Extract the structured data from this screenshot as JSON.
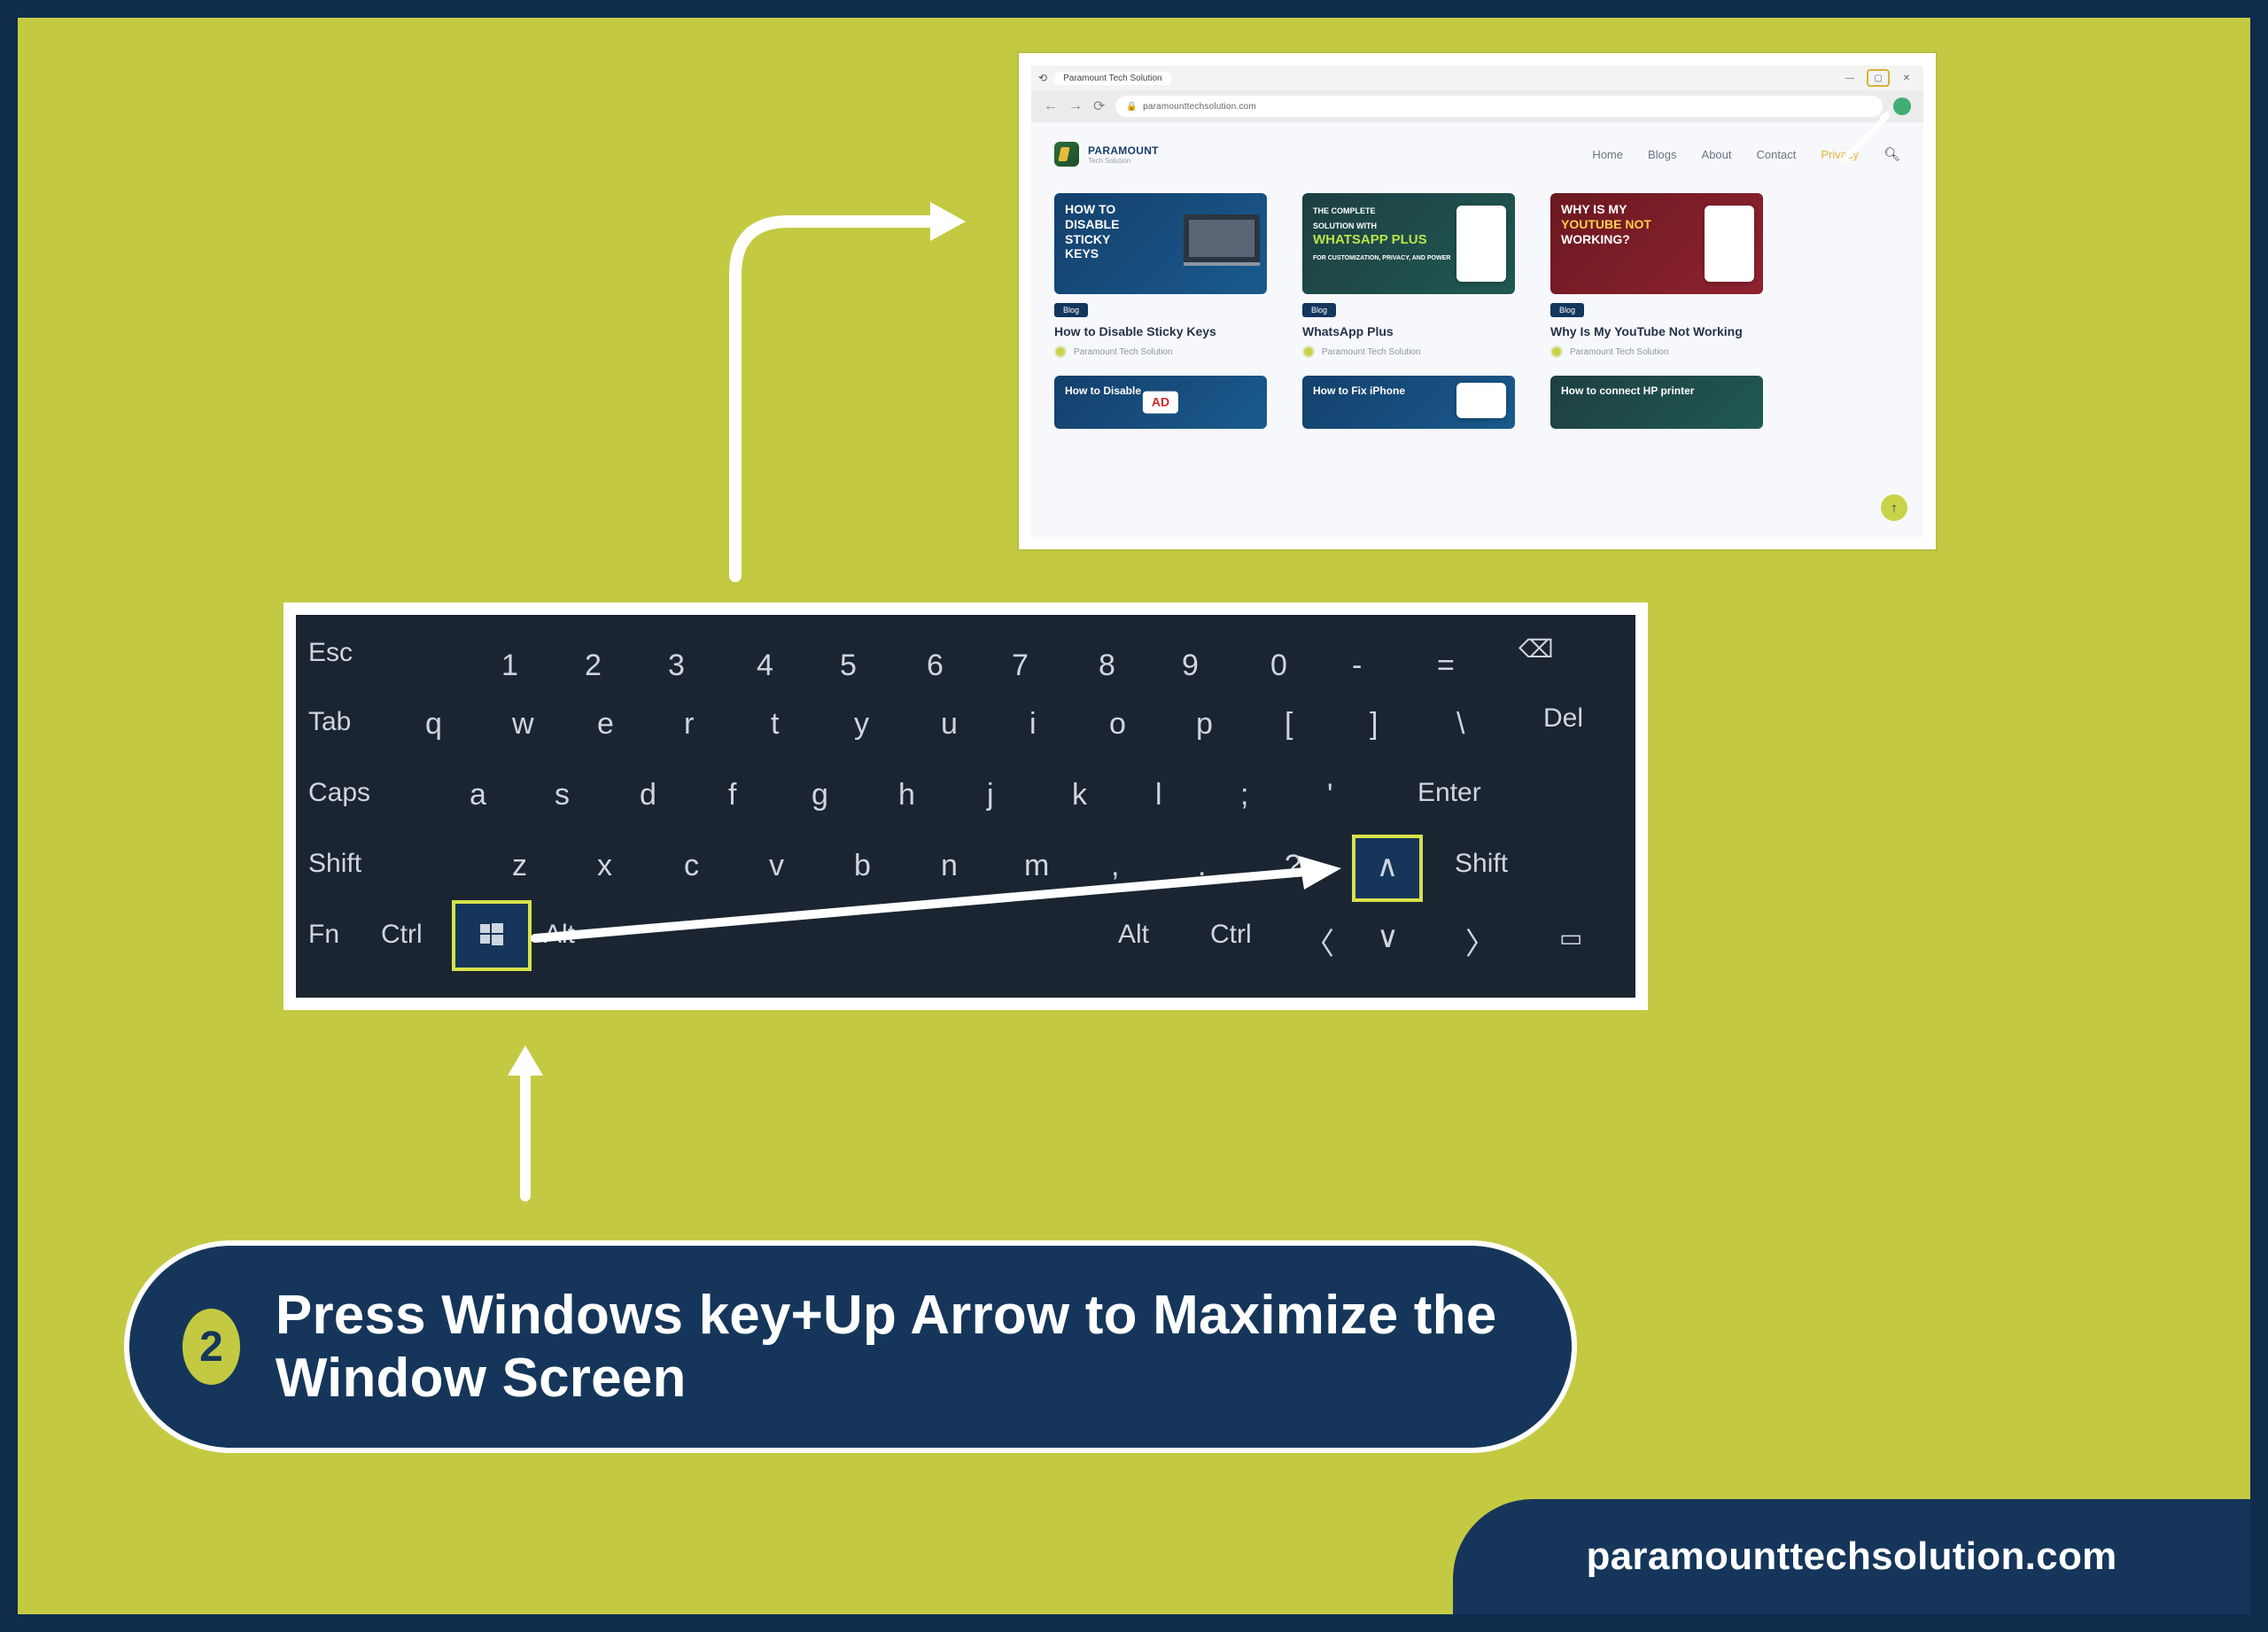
{
  "step": {
    "number": "2",
    "text": "Press Windows key+Up Arrow to Maximize the Window Screen"
  },
  "footer": {
    "site": "paramounttechsolution.com"
  },
  "browser": {
    "tab": "Paramount Tech Solution",
    "url": "paramounttechsolution.com",
    "logo_text": "PARAMOUNT",
    "logo_sub": "Tech Solution",
    "nav": {
      "home": "Home",
      "blogs": "Blogs",
      "about": "About",
      "contact": "Contact",
      "privacy": "Privacy"
    },
    "cards": [
      {
        "thumb_line1": "HOW TO",
        "thumb_line2": "DISABLE",
        "thumb_line3": "STICKY",
        "thumb_line4": "KEYS",
        "badge": "Blog",
        "title": "How to Disable Sticky Keys",
        "author": "Paramount Tech Solution"
      },
      {
        "thumb_line1": "THE COMPLETE",
        "thumb_line2": "SOLUTION WITH",
        "thumb_hl": "WHATSAPP PLUS",
        "thumb_line4": "FOR CUSTOMIZATION, PRIVACY, AND POWER",
        "badge": "Blog",
        "title": "WhatsApp Plus",
        "author": "Paramount Tech Solution"
      },
      {
        "thumb_line1": "WHY IS MY",
        "thumb_hl": "YOUTUBE NOT",
        "thumb_line3": "WORKING?",
        "badge": "Blog",
        "title": "Why Is My YouTube Not Working",
        "author": "Paramount Tech Solution"
      }
    ],
    "row2": [
      {
        "title": "How to Disable",
        "tag": "AD"
      },
      {
        "title": "How to Fix iPhone"
      },
      {
        "title": "How to connect HP printer"
      }
    ]
  },
  "keyboard": {
    "row1": {
      "esc": "Esc",
      "k1": "1",
      "k2": "2",
      "k3": "3",
      "k4": "4",
      "k5": "5",
      "k6": "6",
      "k7": "7",
      "k8": "8",
      "k9": "9",
      "k0": "0",
      "dash": "-",
      "eq": "=",
      "bksp": "⌫"
    },
    "row2": {
      "tab": "Tab",
      "q": "q",
      "w": "w",
      "e": "e",
      "r": "r",
      "t": "t",
      "y": "y",
      "u": "u",
      "i": "i",
      "o": "o",
      "p": "p",
      "lbr": "[",
      "rbr": "]",
      "bslash": "\\",
      "del": "Del"
    },
    "row3": {
      "caps": "Caps",
      "a": "a",
      "s": "s",
      "d": "d",
      "f": "f",
      "g": "g",
      "h": "h",
      "j": "j",
      "k": "k",
      "l": "l",
      "semi": ";",
      "apos": "'",
      "enter": "Enter"
    },
    "row4": {
      "lshift": "Shift",
      "z": "z",
      "x": "x",
      "c": "c",
      "v": "v",
      "b": "b",
      "n": "n",
      "m": "m",
      "comma": ",",
      "period": ".",
      "slash": "?",
      "up": "∧",
      "rshift": "Shift"
    },
    "row5": {
      "fn": "Fn",
      "lctrl": "Ctrl",
      "win": "⊞",
      "lalt": "Alt",
      "ralt": "Alt",
      "rctrl": "Ctrl",
      "left": "〈",
      "down": "∨",
      "right": "〉",
      "menu": "▭"
    }
  }
}
